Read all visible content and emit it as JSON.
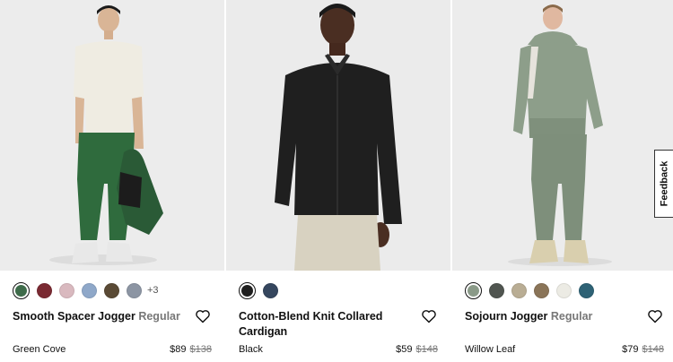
{
  "products": [
    {
      "name": "Smooth Spacer Jogger",
      "fit": "Regular",
      "color_name": "Green Cove",
      "price": "$89",
      "original_price": "$138",
      "swatches": [
        "#3e6b4a",
        "#7a2a32",
        "#d9b9bf",
        "#8fa8c9",
        "#5a4a35",
        "#8c95a3"
      ],
      "selected_swatch": 0,
      "more_colors": "+3"
    },
    {
      "name": "Cotton-Blend Knit Collared Cardigan",
      "fit": "",
      "color_name": "Black",
      "price": "$59",
      "original_price": "$148",
      "swatches": [
        "#1e1e1e",
        "#35465e"
      ],
      "selected_swatch": 0
    },
    {
      "name": "Sojourn Jogger",
      "fit": "Regular",
      "color_name": "Willow Leaf",
      "price": "$79",
      "original_price": "$148",
      "swatches": [
        "#8a9a88",
        "#505550",
        "#b9ad94",
        "#8a7458",
        "#ecebe4",
        "#2e6275"
      ],
      "selected_swatch": 0
    }
  ],
  "feedback_label": "Feedback",
  "icons": {
    "wishlist": "heart-outline-icon"
  }
}
